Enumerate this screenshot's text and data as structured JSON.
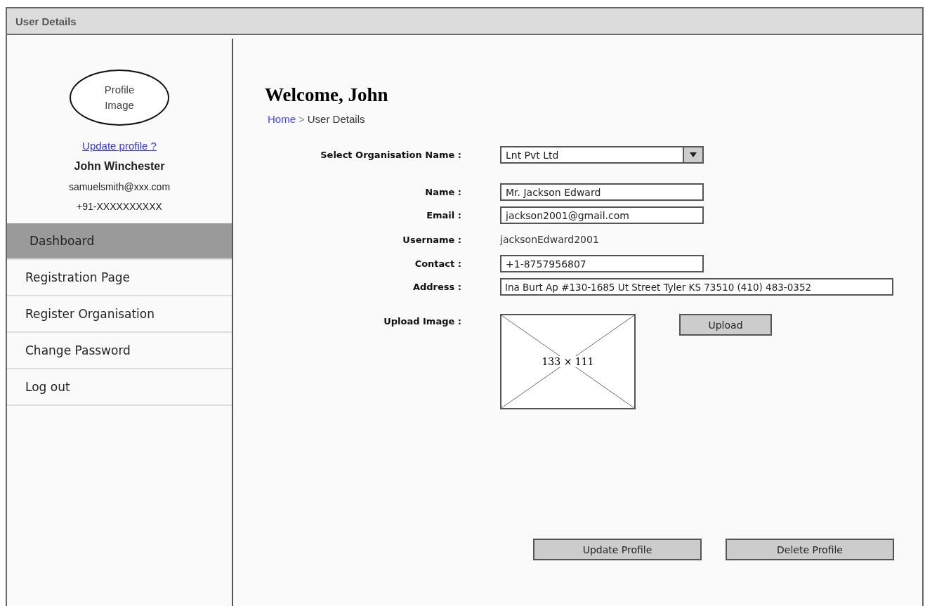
{
  "window": {
    "title": "User Details"
  },
  "sidebar": {
    "avatar_label": "Profile Image",
    "update_link": "Update profile ?",
    "user_name": "John Winchester",
    "email": "samuelsmith@xxx.com",
    "phone": "+91-XXXXXXXXXX",
    "items": [
      {
        "label": "Dashboard",
        "selected": true
      },
      {
        "label": "Registration Page",
        "selected": false
      },
      {
        "label": "Register Organisation",
        "selected": false
      },
      {
        "label": "Change Password",
        "selected": false
      },
      {
        "label": "Log out",
        "selected": false
      }
    ]
  },
  "heading": "Welcome, John",
  "breadcrumb": {
    "link": "Home",
    "separator": ">",
    "current": "User Details"
  },
  "form": [
    {
      "kind": "select",
      "label": "Select Organisation Name :",
      "value": "Lnt Pvt Ltd"
    },
    {
      "kind": "input",
      "label": "Name :",
      "value": "Mr. Jackson Edward"
    },
    {
      "kind": "input",
      "label": "Email :",
      "value": "jackson2001@gmail.com"
    },
    {
      "kind": "text",
      "label": "Username :",
      "value": "jacksonEdward2001"
    },
    {
      "kind": "input",
      "label": "Contact :",
      "value": "+1-8757956807"
    },
    {
      "kind": "wide_input",
      "label": "Address :",
      "value": "Ina Burt Ap #130-1685 Ut Street Tyler KS 73510 (410) 483-0352"
    },
    {
      "kind": "image",
      "label": "Upload Image :",
      "value": "133 × 111",
      "button": "Upload"
    }
  ],
  "actions": [
    "Update Profile",
    "Delete Profile"
  ]
}
